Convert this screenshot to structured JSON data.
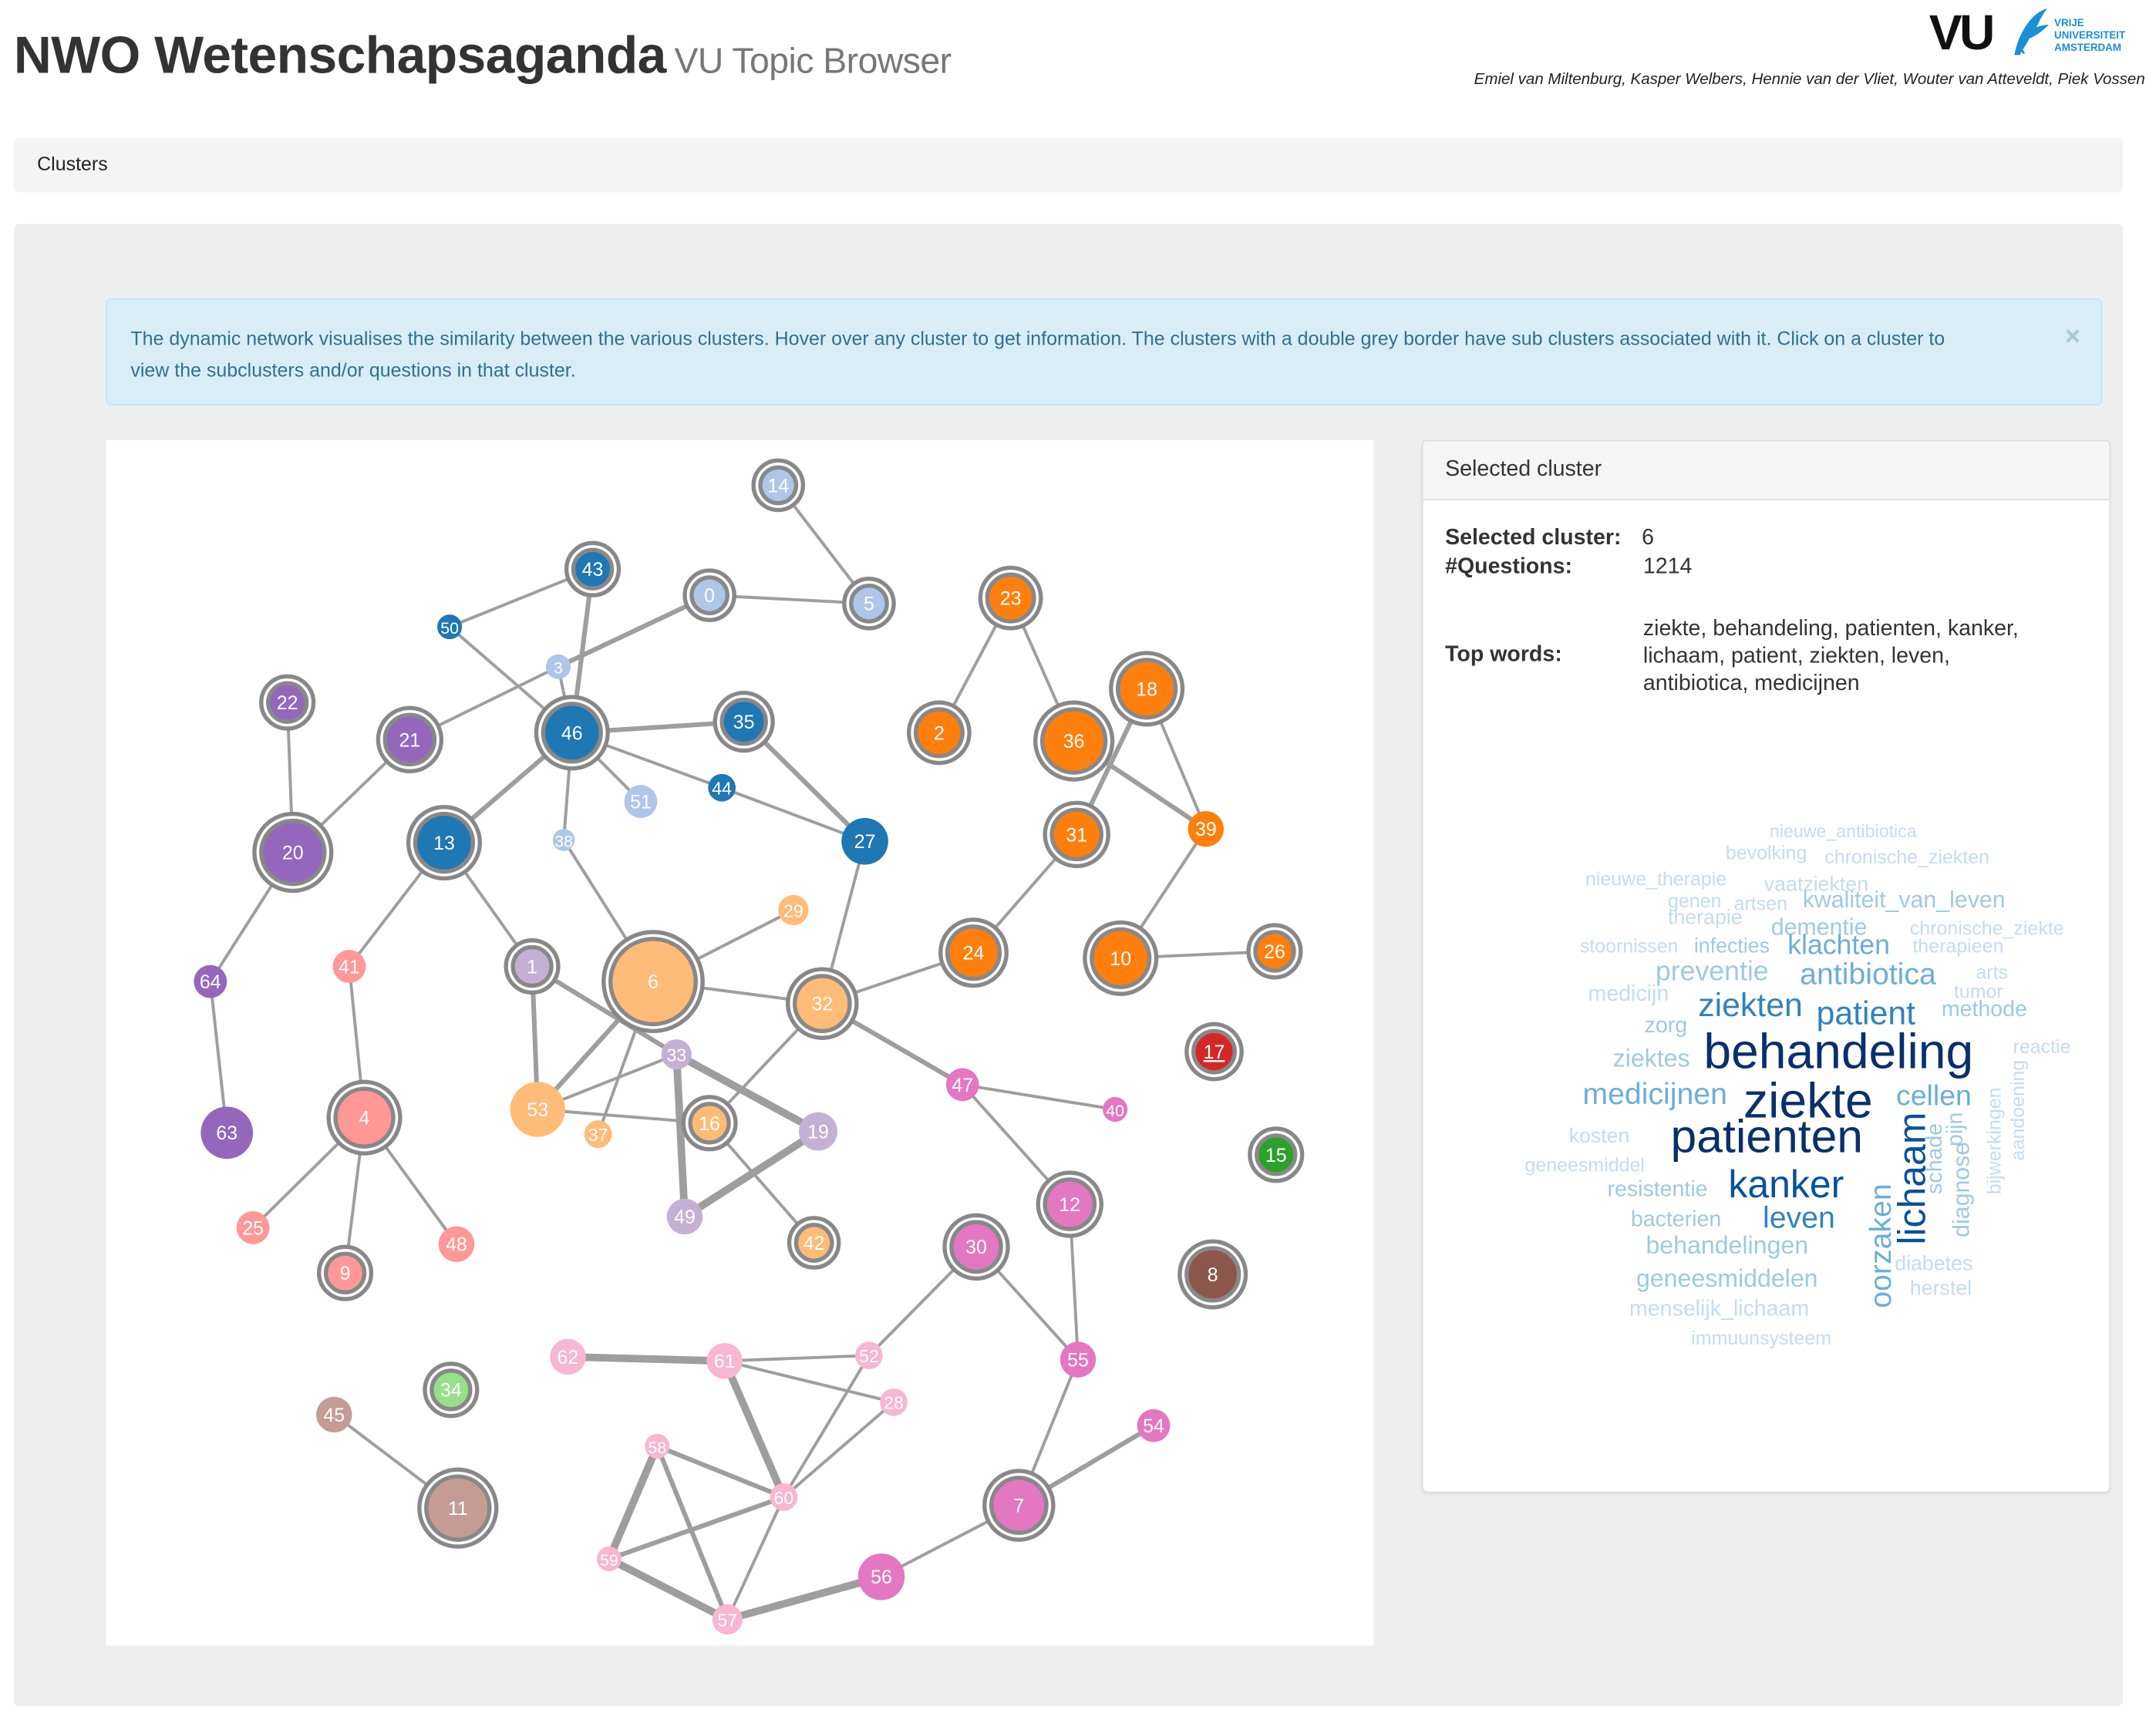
{
  "header": {
    "title": "NWO Wetenschapsaganda",
    "subtitle": "VU Topic Browser",
    "logo": {
      "mark": "VU",
      "lines": [
        "VRIJE",
        "UNIVERSITEIT",
        "AMSTERDAM"
      ]
    },
    "authors": "Emiel van Miltenburg, Kasper Welbers, Hennie van der Vliet, Wouter van Atteveldt, Piek Vossen"
  },
  "breadcrumb": {
    "label": "Clusters"
  },
  "alert": {
    "text": "The dynamic network visualises the similarity between the various clusters. Hover over any cluster to get information. The clusters with a double grey border have sub clusters associated with it. Click on a cluster to view the subclusters and/or questions in that cluster.",
    "close_icon": "×"
  },
  "colors": {
    "blue": "#1f77b4",
    "lightblue": "#aec7e8",
    "orange": "#ff7f0e",
    "lightorange": "#ffbb78",
    "green": "#2ca02c",
    "lightgreen": "#98df8a",
    "red": "#d62728",
    "salmon": "#ff9896",
    "purple": "#9467bd",
    "lavender": "#c5b0d5",
    "brown": "#8c564b",
    "lightbrown": "#c49c94",
    "pink": "#e377c2",
    "lightpink": "#f7b6d2",
    "edge": "#9e9e9e",
    "ring": "#888888"
  },
  "network": {
    "nodes": [
      {
        "id": "14",
        "group": "lightblue",
        "sub": true
      },
      {
        "id": "43",
        "group": "blue",
        "sub": true
      },
      {
        "id": "0",
        "group": "lightblue",
        "sub": true
      },
      {
        "id": "5",
        "group": "lightblue",
        "sub": true
      },
      {
        "id": "50",
        "group": "blue",
        "sub": false
      },
      {
        "id": "3",
        "group": "lightblue",
        "sub": false
      },
      {
        "id": "22",
        "group": "purple",
        "sub": true
      },
      {
        "id": "21",
        "group": "purple",
        "sub": true
      },
      {
        "id": "46",
        "group": "blue",
        "sub": true
      },
      {
        "id": "35",
        "group": "blue",
        "sub": true
      },
      {
        "id": "51",
        "group": "lightblue",
        "sub": false
      },
      {
        "id": "44",
        "group": "blue",
        "sub": false
      },
      {
        "id": "38",
        "group": "lightblue",
        "sub": false
      },
      {
        "id": "13",
        "group": "blue",
        "sub": true
      },
      {
        "id": "20",
        "group": "purple",
        "sub": true
      },
      {
        "id": "27",
        "group": "blue",
        "sub": false
      },
      {
        "id": "23",
        "group": "orange",
        "sub": true
      },
      {
        "id": "2",
        "group": "orange",
        "sub": true
      },
      {
        "id": "36",
        "group": "orange",
        "sub": true
      },
      {
        "id": "18",
        "group": "orange",
        "sub": true
      },
      {
        "id": "31",
        "group": "orange",
        "sub": true
      },
      {
        "id": "39",
        "group": "orange",
        "sub": false
      },
      {
        "id": "24",
        "group": "orange",
        "sub": true
      },
      {
        "id": "10",
        "group": "orange",
        "sub": true
      },
      {
        "id": "26",
        "group": "orange",
        "sub": true
      },
      {
        "id": "29",
        "group": "lightorange",
        "sub": false
      },
      {
        "id": "64",
        "group": "purple",
        "sub": false
      },
      {
        "id": "41",
        "group": "salmon",
        "sub": false
      },
      {
        "id": "1",
        "group": "lavender",
        "sub": true
      },
      {
        "id": "6",
        "group": "lightorange",
        "sub": true,
        "selected": true
      },
      {
        "id": "32",
        "group": "lightorange",
        "sub": true
      },
      {
        "id": "17",
        "group": "red",
        "sub": true
      },
      {
        "id": "33",
        "group": "lavender",
        "sub": false
      },
      {
        "id": "53",
        "group": "lightorange",
        "sub": false
      },
      {
        "id": "37",
        "group": "lightorange",
        "sub": false
      },
      {
        "id": "16",
        "group": "lightorange",
        "sub": true
      },
      {
        "id": "19",
        "group": "lavender",
        "sub": false
      },
      {
        "id": "47",
        "group": "pink",
        "sub": false
      },
      {
        "id": "40",
        "group": "pink",
        "sub": false
      },
      {
        "id": "63",
        "group": "purple",
        "sub": false
      },
      {
        "id": "4",
        "group": "salmon",
        "sub": true
      },
      {
        "id": "15",
        "group": "green",
        "sub": true
      },
      {
        "id": "12",
        "group": "pink",
        "sub": true
      },
      {
        "id": "49",
        "group": "lavender",
        "sub": false
      },
      {
        "id": "25",
        "group": "salmon",
        "sub": false
      },
      {
        "id": "48",
        "group": "salmon",
        "sub": false
      },
      {
        "id": "42",
        "group": "lightorange",
        "sub": true
      },
      {
        "id": "30",
        "group": "pink",
        "sub": true
      },
      {
        "id": "9",
        "group": "salmon",
        "sub": true
      },
      {
        "id": "8",
        "group": "brown",
        "sub": true
      },
      {
        "id": "62",
        "group": "lightpink",
        "sub": false
      },
      {
        "id": "61",
        "group": "lightpink",
        "sub": false
      },
      {
        "id": "52",
        "group": "lightpink",
        "sub": false
      },
      {
        "id": "55",
        "group": "pink",
        "sub": false
      },
      {
        "id": "34",
        "group": "lightgreen",
        "sub": true
      },
      {
        "id": "28",
        "group": "lightpink",
        "sub": false
      },
      {
        "id": "45",
        "group": "lightbrown",
        "sub": false
      },
      {
        "id": "54",
        "group": "pink",
        "sub": false
      },
      {
        "id": "58",
        "group": "lightpink",
        "sub": false
      },
      {
        "id": "60",
        "group": "lightpink",
        "sub": false
      },
      {
        "id": "11",
        "group": "lightbrown",
        "sub": true
      },
      {
        "id": "7",
        "group": "pink",
        "sub": true
      },
      {
        "id": "59",
        "group": "lightpink",
        "sub": false
      },
      {
        "id": "56",
        "group": "pink",
        "sub": false
      },
      {
        "id": "57",
        "group": "lightpink",
        "sub": false
      }
    ],
    "edges": [
      {
        "s": "14",
        "t": "5",
        "w": 1
      },
      {
        "s": "0",
        "t": "5",
        "w": 1
      },
      {
        "s": "0",
        "t": "3",
        "w": 2
      },
      {
        "s": "43",
        "t": "50",
        "w": 1
      },
      {
        "s": "43",
        "t": "46",
        "w": 2
      },
      {
        "s": "50",
        "t": "46",
        "w": 1
      },
      {
        "s": "3",
        "t": "21",
        "w": 1
      },
      {
        "s": "3",
        "t": "46",
        "w": 1
      },
      {
        "s": "46",
        "t": "35",
        "w": 2
      },
      {
        "s": "46",
        "t": "51",
        "w": 1
      },
      {
        "s": "46",
        "t": "44",
        "w": 1
      },
      {
        "s": "44",
        "t": "27",
        "w": 1
      },
      {
        "s": "46",
        "t": "38",
        "w": 1
      },
      {
        "s": "46",
        "t": "13",
        "w": 2
      },
      {
        "s": "35",
        "t": "27",
        "w": 2
      },
      {
        "s": "22",
        "t": "20",
        "w": 1
      },
      {
        "s": "21",
        "t": "20",
        "w": 1
      },
      {
        "s": "20",
        "t": "64",
        "w": 1
      },
      {
        "s": "64",
        "t": "63",
        "w": 1
      },
      {
        "s": "13",
        "t": "41",
        "w": 1
      },
      {
        "s": "13",
        "t": "1",
        "w": 1
      },
      {
        "s": "41",
        "t": "4",
        "w": 1
      },
      {
        "s": "4",
        "t": "25",
        "w": 1
      },
      {
        "s": "4",
        "t": "9",
        "w": 1
      },
      {
        "s": "4",
        "t": "48",
        "w": 1
      },
      {
        "s": "38",
        "t": "6",
        "w": 1
      },
      {
        "s": "27",
        "t": "32",
        "w": 1
      },
      {
        "s": "23",
        "t": "2",
        "w": 1
      },
      {
        "s": "23",
        "t": "36",
        "w": 1
      },
      {
        "s": "18",
        "t": "31",
        "w": 2
      },
      {
        "s": "18",
        "t": "39",
        "w": 1
      },
      {
        "s": "36",
        "t": "39",
        "w": 2
      },
      {
        "s": "31",
        "t": "24",
        "w": 1
      },
      {
        "s": "39",
        "t": "10",
        "w": 1
      },
      {
        "s": "10",
        "t": "26",
        "w": 1
      },
      {
        "s": "24",
        "t": "32",
        "w": 1
      },
      {
        "s": "6",
        "t": "29",
        "w": 1
      },
      {
        "s": "6",
        "t": "32",
        "w": 1
      },
      {
        "s": "6",
        "t": "53",
        "w": 2
      },
      {
        "s": "6",
        "t": "37",
        "w": 1
      },
      {
        "s": "1",
        "t": "53",
        "w": 2
      },
      {
        "s": "1",
        "t": "33",
        "w": 2
      },
      {
        "s": "33",
        "t": "53",
        "w": 1
      },
      {
        "s": "53",
        "t": "16",
        "w": 1
      },
      {
        "s": "33",
        "t": "49",
        "w": 3
      },
      {
        "s": "33",
        "t": "19",
        "w": 3
      },
      {
        "s": "19",
        "t": "49",
        "w": 3
      },
      {
        "s": "32",
        "t": "16",
        "w": 1
      },
      {
        "s": "16",
        "t": "42",
        "w": 1
      },
      {
        "s": "32",
        "t": "47",
        "w": 2
      },
      {
        "s": "47",
        "t": "40",
        "w": 1
      },
      {
        "s": "47",
        "t": "12",
        "w": 1
      },
      {
        "s": "12",
        "t": "55",
        "w": 1
      },
      {
        "s": "30",
        "t": "55",
        "w": 1
      },
      {
        "s": "30",
        "t": "52",
        "w": 1
      },
      {
        "s": "55",
        "t": "7",
        "w": 1
      },
      {
        "s": "7",
        "t": "54",
        "w": 2
      },
      {
        "s": "7",
        "t": "56",
        "w": 1
      },
      {
        "s": "62",
        "t": "61",
        "w": 3
      },
      {
        "s": "61",
        "t": "52",
        "w": 1
      },
      {
        "s": "61",
        "t": "28",
        "w": 1
      },
      {
        "s": "61",
        "t": "60",
        "w": 3
      },
      {
        "s": "52",
        "t": "60",
        "w": 1
      },
      {
        "s": "28",
        "t": "60",
        "w": 1
      },
      {
        "s": "58",
        "t": "60",
        "w": 2
      },
      {
        "s": "58",
        "t": "59",
        "w": 3
      },
      {
        "s": "58",
        "t": "57",
        "w": 2
      },
      {
        "s": "59",
        "t": "60",
        "w": 2
      },
      {
        "s": "59",
        "t": "57",
        "w": 3
      },
      {
        "s": "60",
        "t": "57",
        "w": 1
      },
      {
        "s": "57",
        "t": "56",
        "w": 3
      },
      {
        "s": "45",
        "t": "11",
        "w": 1
      }
    ]
  },
  "selected_panel": {
    "heading": "Selected cluster",
    "selected_label": "Selected cluster:",
    "selected_value": "6",
    "questions_label": "#Questions:",
    "questions_value": "1214",
    "topwords_label": "Top words:",
    "topwords_value": "ziekte, behandeling, patienten, kanker, lichaam, patient, ziekten, leven, antibiotica, medicijnen"
  },
  "wordcloud": [
    {
      "text": "nieuwe_antibiotica",
      "shade": 1
    },
    {
      "text": "bevolking",
      "shade": 1
    },
    {
      "text": "chronische_ziekten",
      "shade": 1
    },
    {
      "text": "nieuwe_therapie",
      "shade": 1
    },
    {
      "text": "vaatziekten",
      "shade": 1
    },
    {
      "text": "genen",
      "shade": 1
    },
    {
      "text": "artsen",
      "shade": 1
    },
    {
      "text": "kwaliteit_van_leven",
      "shade": 2
    },
    {
      "text": "therapie",
      "shade": 1
    },
    {
      "text": "dementie",
      "shade": 2
    },
    {
      "text": "chronische_ziekte",
      "shade": 1
    },
    {
      "text": "stoornissen",
      "shade": 1
    },
    {
      "text": "infecties",
      "shade": 2
    },
    {
      "text": "klachten",
      "shade": 3
    },
    {
      "text": "therapieen",
      "shade": 1
    },
    {
      "text": "preventie",
      "shade": 2
    },
    {
      "text": "antibiotica",
      "shade": 3
    },
    {
      "text": "arts",
      "shade": 1
    },
    {
      "text": "tumor",
      "shade": 1
    },
    {
      "text": "medicijn",
      "shade": 1
    },
    {
      "text": "ziekten",
      "shade": 4
    },
    {
      "text": "patient",
      "shade": 4
    },
    {
      "text": "methode",
      "shade": 2
    },
    {
      "text": "zorg",
      "shade": 2
    },
    {
      "text": "behandeling",
      "shade": 6
    },
    {
      "text": "reactie",
      "shade": 1
    },
    {
      "text": "ziektes",
      "shade": 2
    },
    {
      "text": "medicijnen",
      "shade": 3
    },
    {
      "text": "ziekte",
      "shade": 6
    },
    {
      "text": "cellen",
      "shade": 3
    },
    {
      "text": "kosten",
      "shade": 1
    },
    {
      "text": "patienten",
      "shade": 6
    },
    {
      "text": "lichaam",
      "shade": 5
    },
    {
      "text": "schade",
      "shade": 2
    },
    {
      "text": "pijn",
      "shade": 2
    },
    {
      "text": "diagnose",
      "shade": 2
    },
    {
      "text": "bijwerkingen",
      "shade": 1
    },
    {
      "text": "aandoening",
      "shade": 1
    },
    {
      "text": "geneesmiddel",
      "shade": 1
    },
    {
      "text": "resistentie",
      "shade": 2
    },
    {
      "text": "kanker",
      "shade": 5
    },
    {
      "text": "oorzaken",
      "shade": 3
    },
    {
      "text": "bacterien",
      "shade": 2
    },
    {
      "text": "leven",
      "shade": 4
    },
    {
      "text": "behandelingen",
      "shade": 2
    },
    {
      "text": "diabetes",
      "shade": 1
    },
    {
      "text": "geneesmiddelen",
      "shade": 2
    },
    {
      "text": "herstel",
      "shade": 1
    },
    {
      "text": "menselijk_lichaam",
      "shade": 1
    },
    {
      "text": "immuunsysteem",
      "shade": 1
    }
  ],
  "wordcloud_shades": [
    "#c6dbef",
    "#9ecae1",
    "#6baed6",
    "#3182bd",
    "#08519c",
    "#08306b"
  ]
}
